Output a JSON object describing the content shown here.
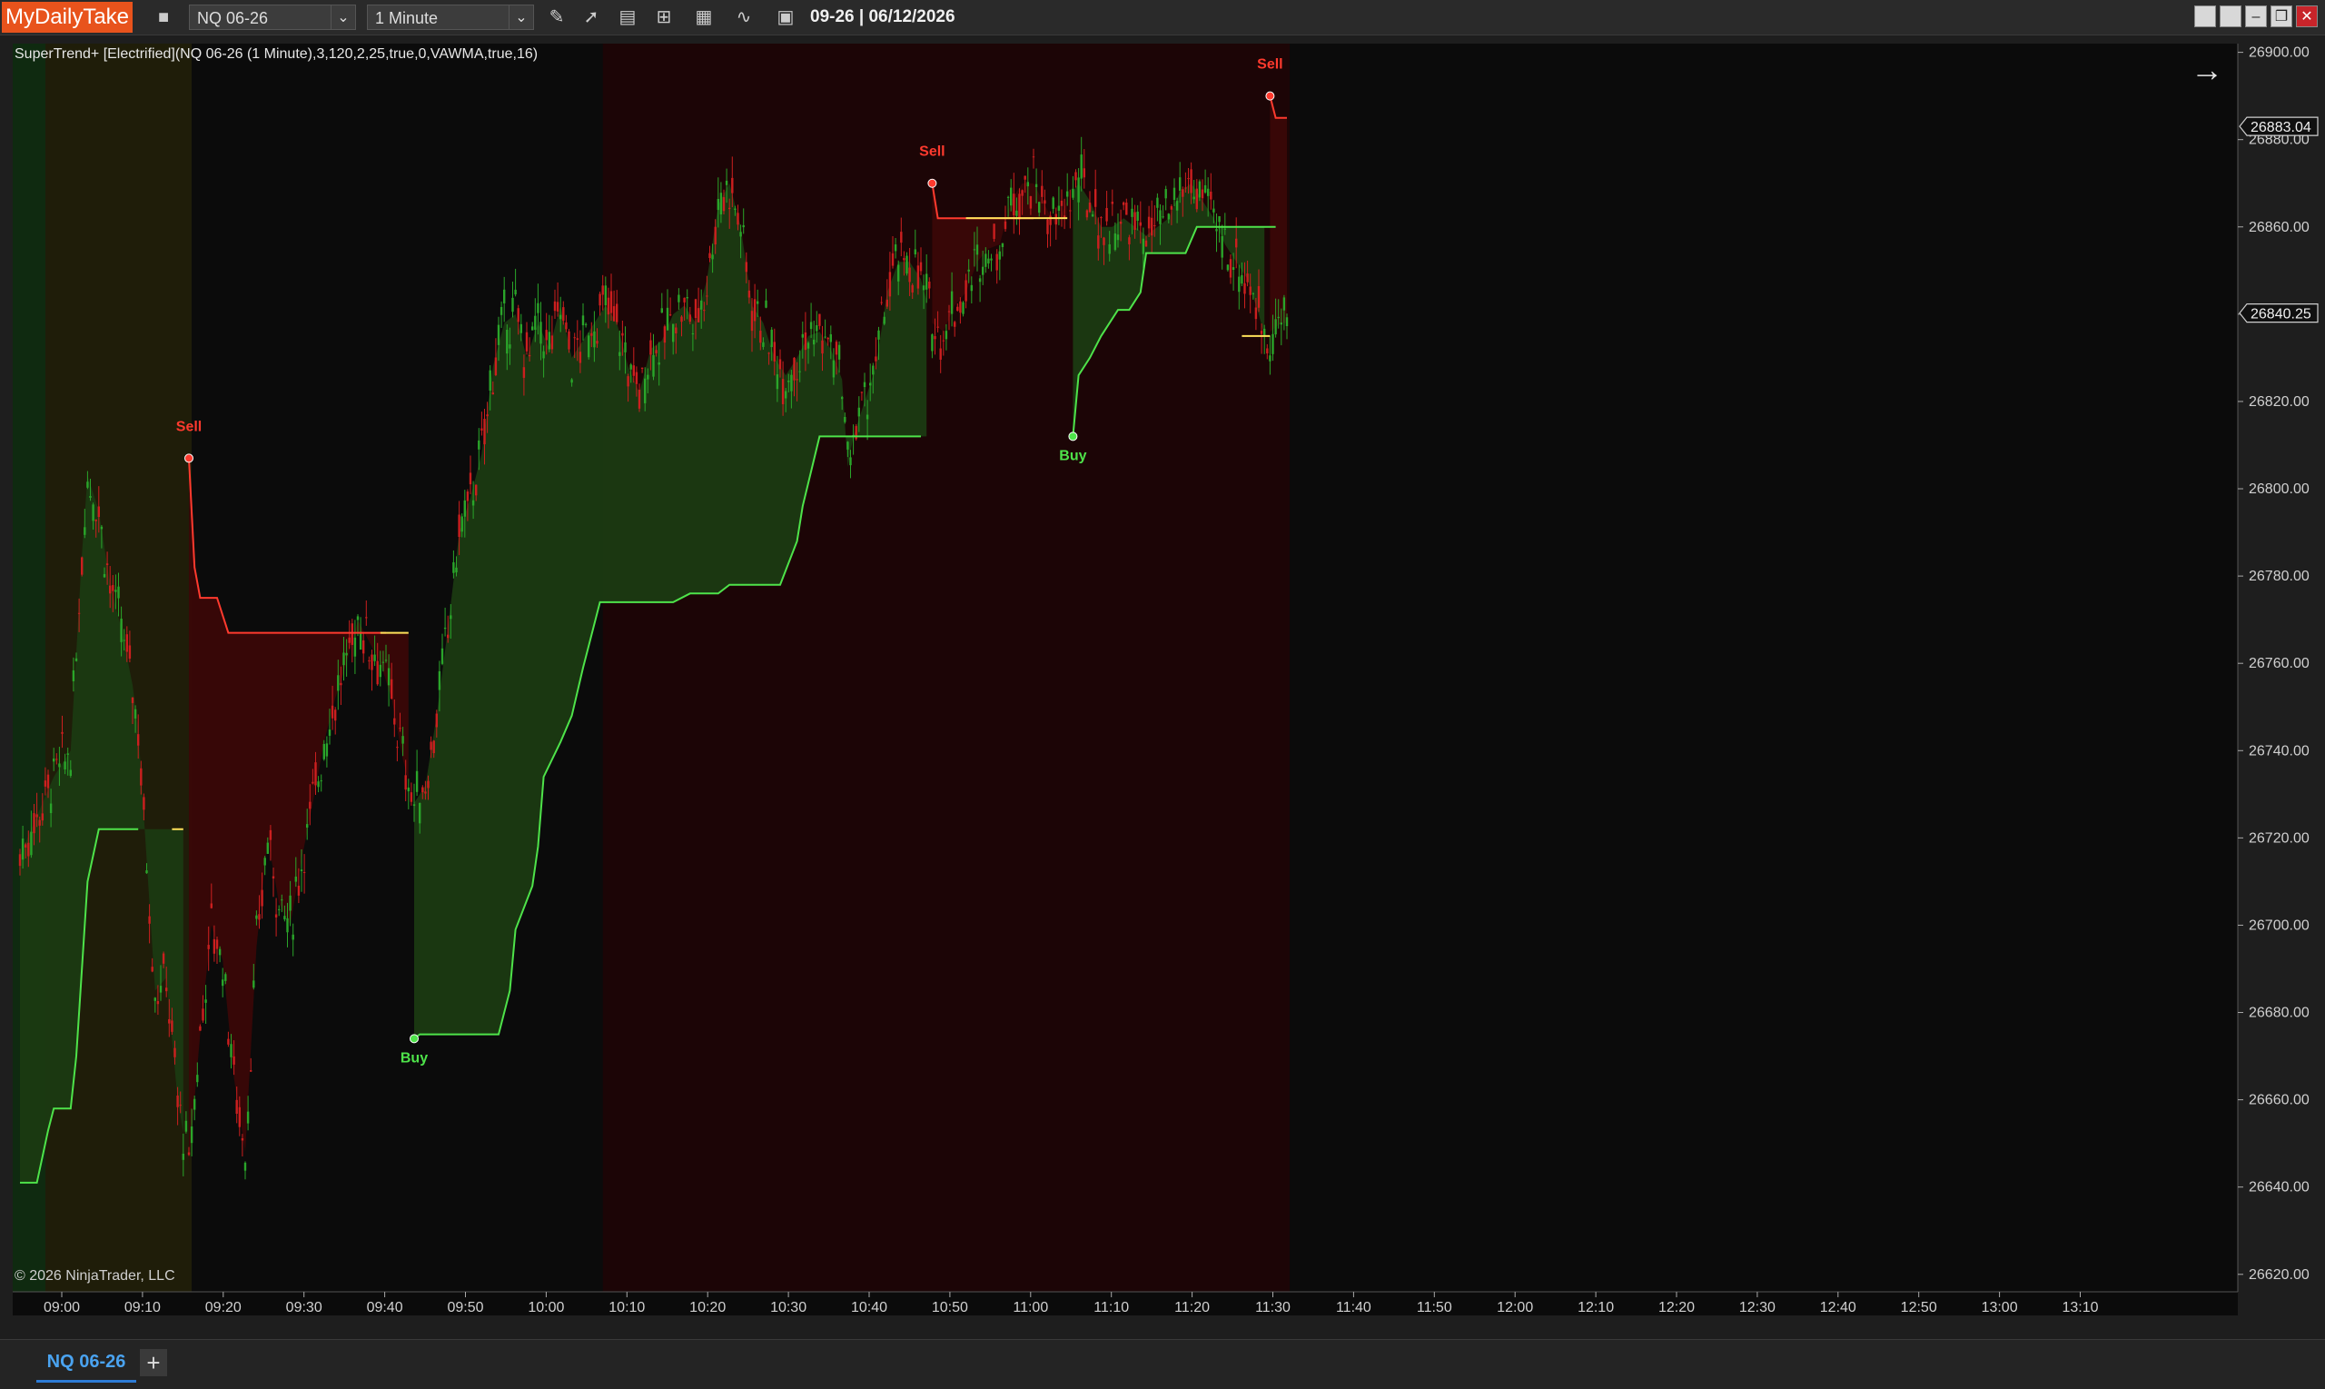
{
  "toolbar": {
    "brand": "MyDailyTake",
    "instrument": "NQ 06-26",
    "interval": "1 Minute",
    "date_string": "09-26 | 06/12/2026"
  },
  "chart": {
    "indicator_label": "SuperTrend+ [Electrified](NQ 06-26 (1 Minute),3,120,2,25,true,0,VAWMA,true,16)",
    "copyright": "© 2026 NinjaTrader, LLC",
    "price_labels": {
      "last": "26840.25",
      "high": "26883.04"
    }
  },
  "colors": {
    "background": "#0b0b0b",
    "uptrend_fill": "#1b3a12",
    "downtrend_fill": "#3a0707",
    "session_tint_green": "#0f2a10",
    "session_tint_olive": "#1f1d09",
    "session_tint_red": "#1c0506",
    "up_line": "#4ee34a",
    "down_line": "#ff3a2e",
    "flat_line": "#ffe15a",
    "up_candle": "#2aa52a",
    "down_candle": "#cc1f1f"
  },
  "tabs": {
    "active": "NQ 06-26"
  },
  "chart_data": {
    "type": "candlestick",
    "title": "",
    "x_ticks": [
      "09:00",
      "09:10",
      "09:20",
      "09:30",
      "09:40",
      "09:50",
      "10:00",
      "10:10",
      "10:20",
      "10:30",
      "10:40",
      "10:50",
      "11:00",
      "11:10",
      "11:20",
      "11:30",
      "11:40",
      "11:50",
      "12:00",
      "12:10",
      "12:20",
      "12:30",
      "12:40",
      "12:50",
      "13:00",
      "13:10"
    ],
    "y_ticks": [
      26620,
      26640,
      26660,
      26680,
      26700,
      26720,
      26740,
      26760,
      26780,
      26800,
      26820,
      26840,
      26860,
      26880,
      26900
    ],
    "ylim": [
      26616,
      26902
    ],
    "grid": false,
    "price_points": [
      [
        0,
        26716
      ],
      [
        3,
        26725
      ],
      [
        6,
        26734
      ],
      [
        9,
        26740
      ],
      [
        11,
        26785
      ],
      [
        12,
        26803
      ],
      [
        14,
        26795
      ],
      [
        16,
        26778
      ],
      [
        18,
        26768
      ],
      [
        20,
        26755
      ],
      [
        21,
        26745
      ],
      [
        22,
        26725
      ],
      [
        24,
        26685
      ],
      [
        26,
        26688
      ],
      [
        28,
        26660
      ],
      [
        30,
        26645
      ],
      [
        32,
        26675
      ],
      [
        34,
        26700
      ],
      [
        36,
        26692
      ],
      [
        38,
        26665
      ],
      [
        40,
        26648
      ],
      [
        42,
        26695
      ],
      [
        44,
        26720
      ],
      [
        46,
        26705
      ],
      [
        48,
        26700
      ],
      [
        50,
        26715
      ],
      [
        52,
        26728
      ],
      [
        54,
        26742
      ],
      [
        56,
        26752
      ],
      [
        58,
        26760
      ],
      [
        60,
        26770
      ],
      [
        62,
        26765
      ],
      [
        64,
        26760
      ],
      [
        66,
        26752
      ],
      [
        68,
        26738
      ],
      [
        70,
        26728
      ],
      [
        72,
        26732
      ],
      [
        74,
        26748
      ],
      [
        76,
        26768
      ],
      [
        78,
        26790
      ],
      [
        80,
        26798
      ],
      [
        82,
        26808
      ],
      [
        84,
        26828
      ],
      [
        86,
        26838
      ],
      [
        88,
        26840
      ],
      [
        90,
        26830
      ],
      [
        92,
        26838
      ],
      [
        94,
        26832
      ],
      [
        96,
        26842
      ],
      [
        98,
        26830
      ],
      [
        100,
        26834
      ],
      [
        102,
        26838
      ],
      [
        104,
        26842
      ],
      [
        106,
        26838
      ],
      [
        108,
        26828
      ],
      [
        110,
        26822
      ],
      [
        112,
        26832
      ],
      [
        114,
        26834
      ],
      [
        116,
        26840
      ],
      [
        118,
        26842
      ],
      [
        120,
        26838
      ],
      [
        122,
        26848
      ],
      [
        124,
        26865
      ],
      [
        126,
        26870
      ],
      [
        128,
        26860
      ],
      [
        130,
        26842
      ],
      [
        132,
        26838
      ],
      [
        134,
        26830
      ],
      [
        136,
        26826
      ],
      [
        138,
        26830
      ],
      [
        140,
        26835
      ],
      [
        142,
        26836
      ],
      [
        144,
        26832
      ],
      [
        146,
        26825
      ],
      [
        147,
        26805
      ],
      [
        148,
        26812
      ],
      [
        150,
        26820
      ],
      [
        152,
        26828
      ],
      [
        154,
        26845
      ],
      [
        156,
        26852
      ],
      [
        158,
        26852
      ],
      [
        160,
        26848
      ],
      [
        162,
        26838
      ],
      [
        164,
        26836
      ],
      [
        166,
        26842
      ],
      [
        168,
        26845
      ],
      [
        170,
        26852
      ],
      [
        172,
        26855
      ],
      [
        174,
        26856
      ],
      [
        176,
        26866
      ],
      [
        178,
        26870
      ],
      [
        180,
        26870
      ],
      [
        182,
        26865
      ],
      [
        184,
        26860
      ],
      [
        186,
        26866
      ],
      [
        188,
        26870
      ],
      [
        190,
        26866
      ],
      [
        192,
        26860
      ],
      [
        194,
        26860
      ],
      [
        196,
        26862
      ],
      [
        198,
        26860
      ],
      [
        200,
        26858
      ],
      [
        202,
        26860
      ],
      [
        204,
        26862
      ],
      [
        206,
        26868
      ],
      [
        208,
        26870
      ],
      [
        210,
        26866
      ],
      [
        212,
        26862
      ],
      [
        214,
        26856
      ],
      [
        216,
        26852
      ],
      [
        218,
        26848
      ],
      [
        220,
        26840
      ],
      [
        221,
        26835
      ],
      [
        222,
        26836
      ],
      [
        224,
        26838
      ],
      [
        225,
        26838
      ]
    ],
    "supertrend_segments": [
      {
        "trend": "up",
        "points": [
          [
            0,
            26641
          ],
          [
            3,
            26641
          ],
          [
            5,
            26653
          ],
          [
            6,
            26658
          ],
          [
            9,
            26658
          ],
          [
            10,
            26670
          ],
          [
            12,
            26710
          ],
          [
            14,
            26722
          ],
          [
            20,
            26722
          ],
          [
            21,
            26722
          ]
        ]
      },
      {
        "trend": "down",
        "points": [
          [
            30,
            26807
          ],
          [
            31,
            26782
          ],
          [
            32,
            26775
          ],
          [
            35,
            26775
          ],
          [
            37,
            26767
          ],
          [
            65,
            26767
          ]
        ]
      },
      {
        "trend": "up",
        "points": [
          [
            70,
            26674
          ],
          [
            71,
            26675
          ],
          [
            85,
            26675
          ],
          [
            87,
            26685
          ],
          [
            88,
            26699
          ],
          [
            91,
            26709
          ],
          [
            92,
            26718
          ],
          [
            93,
            26734
          ],
          [
            96,
            26742
          ],
          [
            98,
            26748
          ],
          [
            100,
            26759
          ],
          [
            101,
            26764
          ],
          [
            103,
            26774
          ],
          [
            116,
            26774
          ],
          [
            119,
            26776
          ],
          [
            124,
            26776
          ],
          [
            126,
            26778
          ],
          [
            135,
            26778
          ],
          [
            138,
            26788
          ],
          [
            139,
            26796
          ],
          [
            142,
            26812
          ],
          [
            160,
            26812
          ]
        ]
      },
      {
        "trend": "down",
        "points": [
          [
            162,
            26870
          ],
          [
            163,
            26862
          ],
          [
            180,
            26862
          ]
        ]
      },
      {
        "trend": "up",
        "points": [
          [
            187,
            26812
          ],
          [
            188,
            26826
          ],
          [
            190,
            26830
          ],
          [
            192,
            26835
          ],
          [
            195,
            26841
          ],
          [
            197,
            26841
          ],
          [
            199,
            26845
          ],
          [
            200,
            26854
          ],
          [
            207,
            26854
          ],
          [
            209,
            26860
          ],
          [
            223,
            26860
          ]
        ]
      },
      {
        "trend": "down",
        "points": [
          [
            222,
            26890
          ],
          [
            223,
            26885
          ],
          [
            225,
            26885
          ]
        ]
      }
    ],
    "flat_markers": [
      {
        "from": 27,
        "to": 29,
        "value": 26722
      },
      {
        "from": 64,
        "to": 69,
        "value": 26767
      },
      {
        "from": 168,
        "to": 186,
        "value": 26862
      },
      {
        "from": 217,
        "to": 222,
        "value": 26835
      }
    ],
    "signals": [
      {
        "type": "Sell",
        "x": 30,
        "value": 26807
      },
      {
        "type": "Buy",
        "x": 70,
        "value": 26674
      },
      {
        "type": "Sell",
        "x": 162,
        "value": 26870
      },
      {
        "type": "Buy",
        "x": 187,
        "value": 26812
      },
      {
        "type": "Sell",
        "x": 222,
        "value": 26890
      }
    ],
    "trend_fills": [
      {
        "trend": "up",
        "from": 0,
        "to": 29
      },
      {
        "trend": "down",
        "from": 30,
        "to": 69
      },
      {
        "trend": "up",
        "from": 70,
        "to": 161
      },
      {
        "trend": "down",
        "from": 162,
        "to": 186
      },
      {
        "trend": "up",
        "from": 187,
        "to": 221
      },
      {
        "trend": "down",
        "from": 222,
        "to": 225
      }
    ],
    "session_bands": [
      {
        "tint": "green",
        "from": 0,
        "to": 5
      },
      {
        "tint": "olive",
        "from": 5,
        "to": 30
      },
      {
        "tint": "red",
        "from": 104,
        "to": 225
      }
    ],
    "last_price": 26840.25,
    "high_price": 26883.04
  }
}
